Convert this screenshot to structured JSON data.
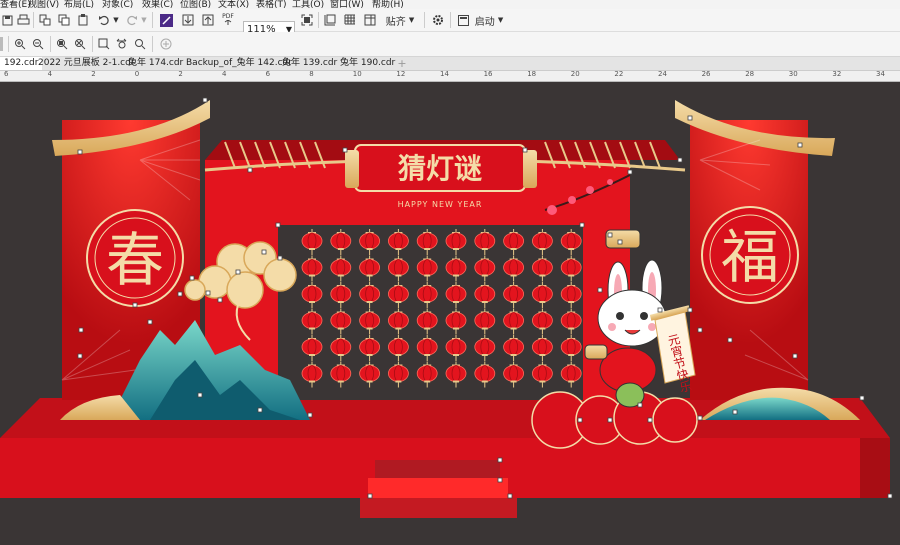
{
  "menu": {
    "items": [
      "查看(E)",
      "视图(V)",
      "布局(L)",
      "对象(C)",
      "效果(C)",
      "位图(B)",
      "文本(X)",
      "表格(T)",
      "工具(O)",
      "窗口(W)",
      "帮助(H)"
    ]
  },
  "toolbar": {
    "zoom_value": "111%",
    "snap_label": "贴齐",
    "launch_label": "启动",
    "pdf_label": "PDF"
  },
  "tabs": [
    {
      "label": "192.cdr",
      "active": true
    },
    {
      "label": "2022 元旦展板 2-1.cdr",
      "active": false
    },
    {
      "label": "兔年 174.cdr",
      "active": false
    },
    {
      "label": "Backup_of_兔年 142.cdr",
      "active": false
    },
    {
      "label": "兔年 139.cdr",
      "active": false
    },
    {
      "label": "兔年 190.cdr",
      "active": false
    }
  ],
  "ruler": {
    "labels": [
      "6",
      "4",
      "2",
      "0",
      "2",
      "4",
      "6",
      "8",
      "10",
      "12",
      "14",
      "16",
      "18",
      "20",
      "22",
      "24",
      "26",
      "28",
      "30",
      "32",
      "34"
    ]
  },
  "design": {
    "title": "猜灯谜",
    "subtitle": "HAPPY NEW YEAR",
    "left_char": "春",
    "right_char": "福",
    "scroll_text": "元宵节快乐",
    "colors": {
      "red": "#d8101c",
      "dark_red": "#a80d14",
      "gold": "#e8c98a",
      "teal": "#2a9c9a",
      "background": "#3a3535"
    }
  }
}
